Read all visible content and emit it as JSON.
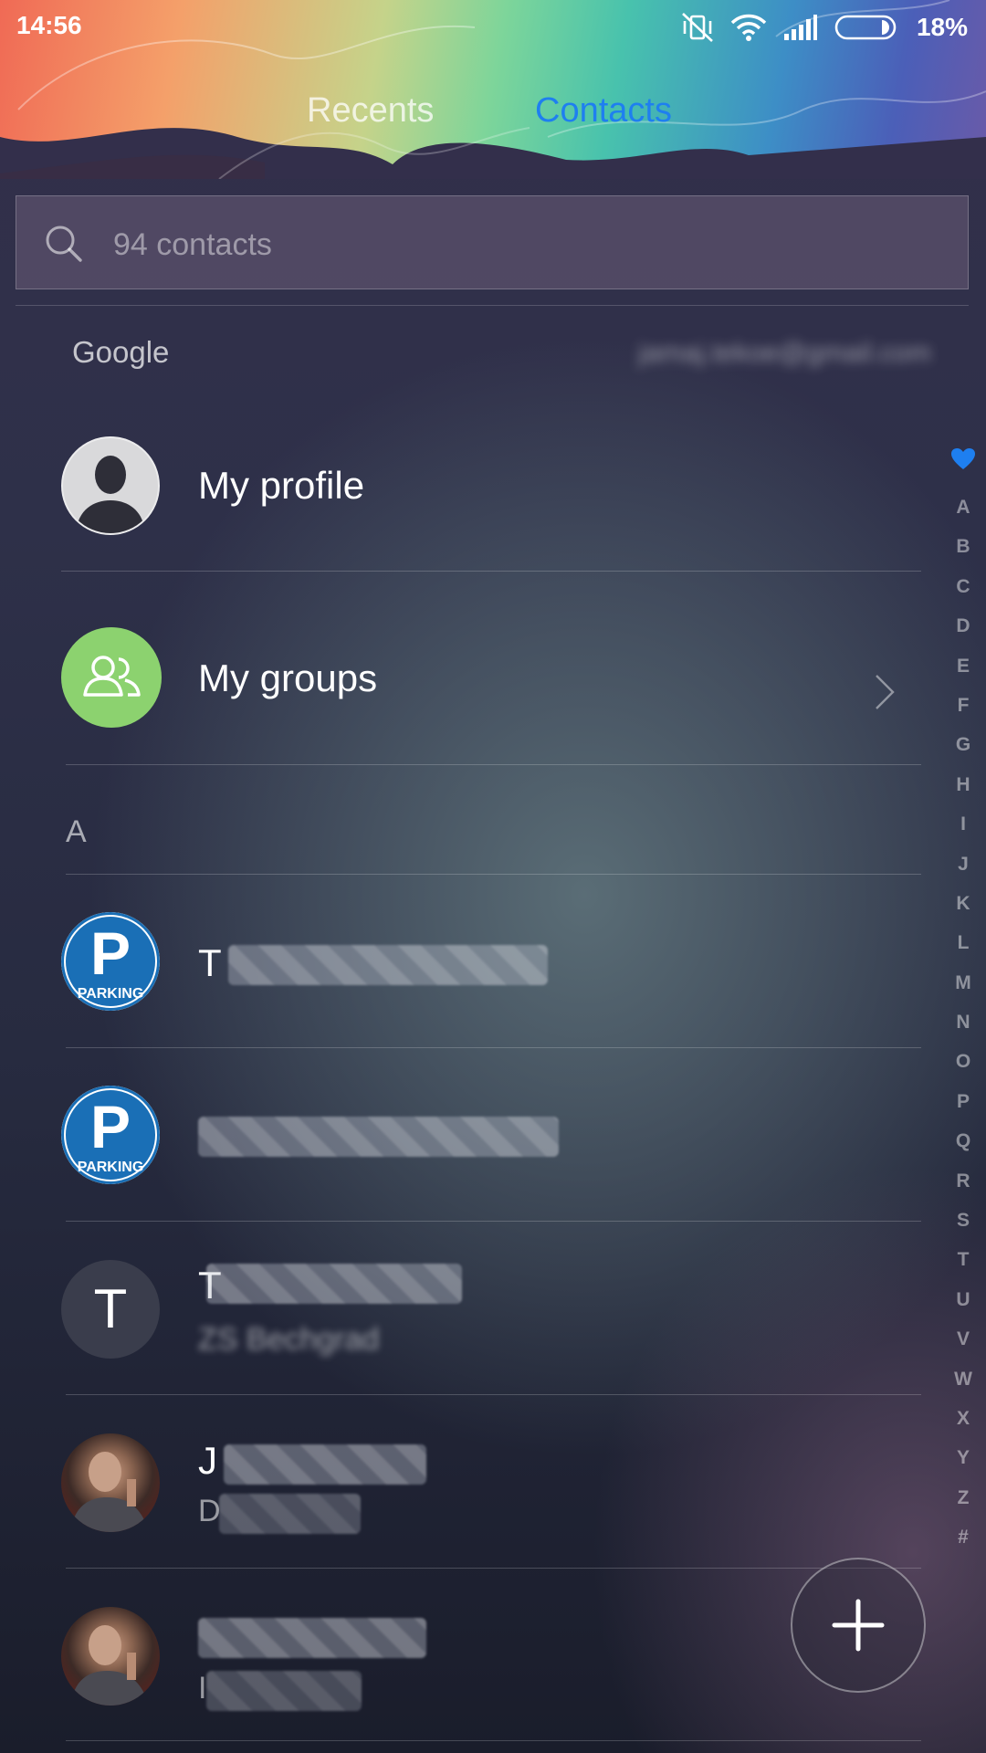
{
  "status_bar": {
    "time": "14:56",
    "battery_percent": "18%",
    "icons": [
      "vibrate-off-icon",
      "wifi-icon",
      "signal-icon",
      "battery-icon"
    ]
  },
  "tabs": [
    {
      "label": "Recents",
      "active": false
    },
    {
      "label": "Contacts",
      "active": true
    }
  ],
  "search": {
    "placeholder": "94 contacts",
    "value": ""
  },
  "account": {
    "label": "Google",
    "email": "jamaj.tekoe@gmail.com"
  },
  "special_rows": {
    "profile": {
      "label": "My profile",
      "icon": "person-silhouette-icon"
    },
    "groups": {
      "label": "My groups",
      "icon": "group-icon",
      "accent": "#8cd26f"
    }
  },
  "section": {
    "letter": "A"
  },
  "contacts": [
    {
      "initial": "T",
      "avatar": "parking-sign",
      "subtitle": ""
    },
    {
      "initial": "",
      "avatar": "parking-sign",
      "subtitle": ""
    },
    {
      "initial": "T",
      "avatar": "letter-T",
      "subtitle": "ZS Bechgrad"
    },
    {
      "initial": "J",
      "avatar": "photo",
      "subtitle": "D"
    },
    {
      "initial": "",
      "avatar": "photo",
      "subtitle": "I"
    }
  ],
  "parking_label": "PARKING",
  "parking_letter": "P",
  "avatar_letter": "T",
  "alpha_index": [
    "A",
    "B",
    "C",
    "D",
    "E",
    "F",
    "G",
    "H",
    "I",
    "J",
    "K",
    "L",
    "M",
    "N",
    "O",
    "P",
    "Q",
    "R",
    "S",
    "T",
    "U",
    "V",
    "W",
    "X",
    "Y",
    "Z",
    "#"
  ],
  "colors": {
    "accent": "#1e7ff0",
    "groups_green": "#8cd26f",
    "parking_blue": "#1a6fb6"
  },
  "fab": {
    "icon": "plus-icon"
  }
}
